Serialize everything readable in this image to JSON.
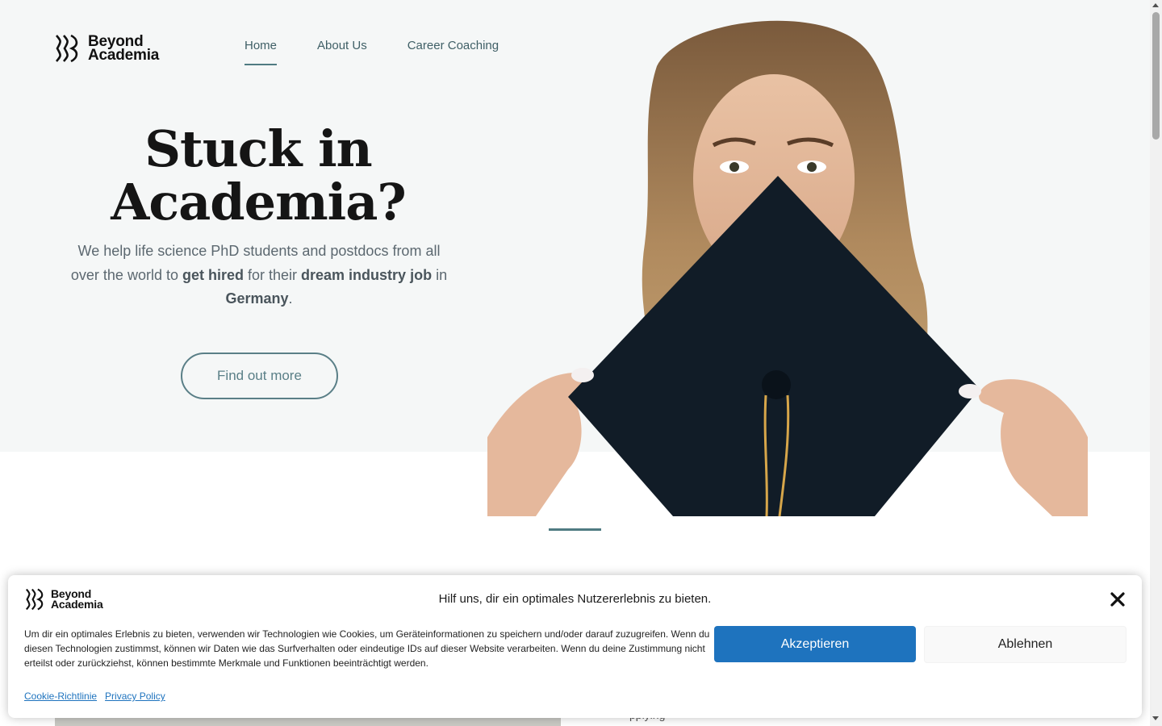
{
  "brand": {
    "name_line1": "Beyond",
    "name_line2": "Academia"
  },
  "nav": {
    "items": [
      {
        "label": "Home",
        "active": true
      },
      {
        "label": "About Us",
        "active": false
      },
      {
        "label": "Career Coaching",
        "active": false
      }
    ]
  },
  "hero": {
    "title_line1": "Stuck in",
    "title_line2": "Academia?",
    "sub_1": "We help life science PhD students and postdocs from all over the world to ",
    "sub_b1": "get hired",
    "sub_2": " for their ",
    "sub_b2": "dream industry job",
    "sub_3": " in ",
    "sub_b3": "Germany",
    "sub_4": ".",
    "cta": "Find out more",
    "image_icon": "graduate-holding-cap-photo"
  },
  "below_fold": {
    "peek_text": "pplying"
  },
  "cookie": {
    "title": "Hilf uns, dir ein optimales Nutzererlebnis zu bieten.",
    "text": "Um dir ein optimales Erlebnis zu bieten, verwenden wir Technologien wie Cookies, um Geräteinformationen zu speichern und/oder darauf zuzugreifen. Wenn du diesen Technologien zustimmst, können wir Daten wie das Surfverhalten oder eindeutige IDs auf dieser Website verarbeiten. Wenn du deine Zustimmung nicht erteilst oder zurückziehst, können bestimmte Merkmale und Funktionen beeinträchtigt werden.",
    "accept": "Akzeptieren",
    "deny": "Ablehnen",
    "link_cookie": "Cookie-Richtlinie",
    "link_privacy": "Privacy Policy"
  },
  "colors": {
    "accent": "#4f7b82",
    "hero_bg": "#f5f7f7",
    "accept_btn": "#1e73be"
  }
}
